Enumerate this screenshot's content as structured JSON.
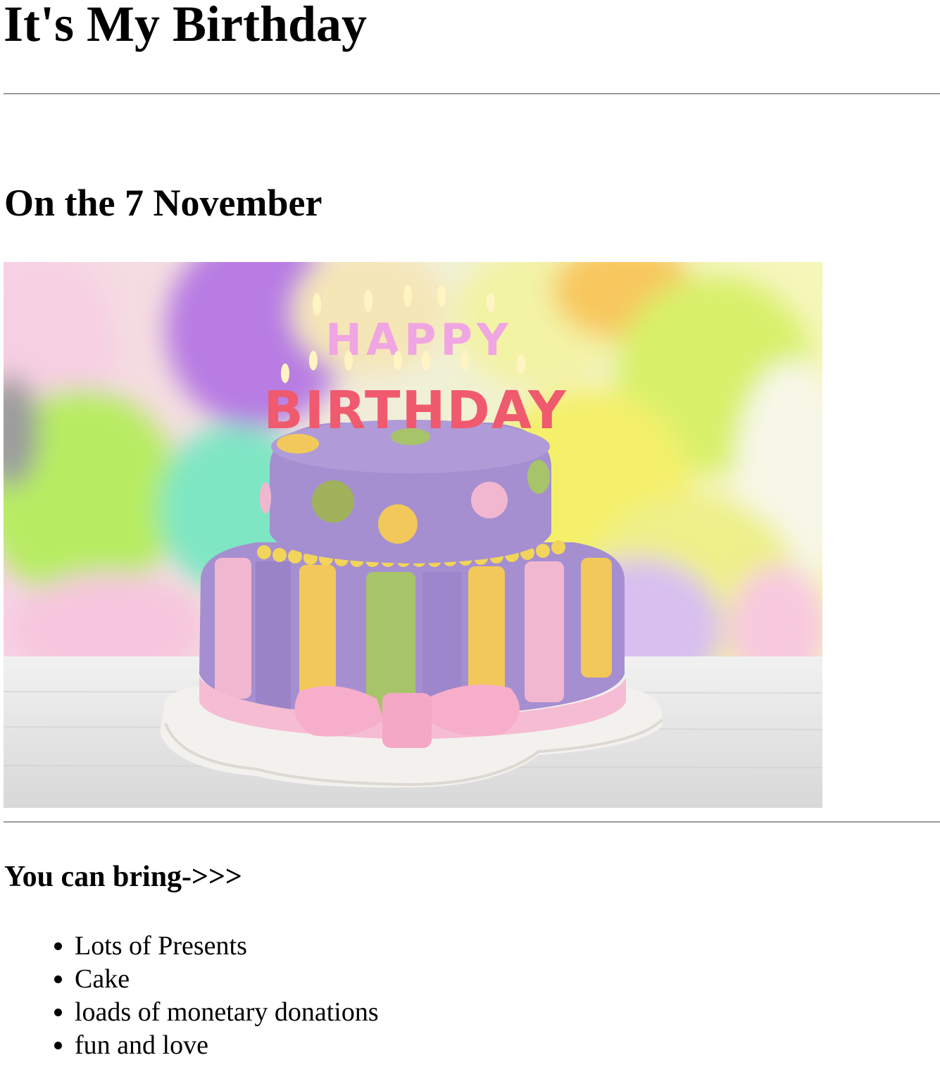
{
  "page": {
    "title": "It's My Birthday",
    "date_heading": "On the 7 November",
    "bring_heading": "You can bring->>>",
    "bring_items": [
      "Lots of Presents",
      "Cake",
      "loads of monetary donations",
      "fun and love"
    ]
  },
  "image": {
    "description_label": "birthday cake photo",
    "topper_line_1": "HAPPY",
    "topper_line_2": "BIRTHDAY",
    "colors": {
      "cake_purple": "#a58fd0",
      "stripe_yellow": "#f2c85a",
      "stripe_green": "#a7c46a",
      "stripe_pink": "#f2b7d0",
      "ribbon_pink": "#f6bcd3",
      "plate_white": "#f3f1ee"
    }
  }
}
